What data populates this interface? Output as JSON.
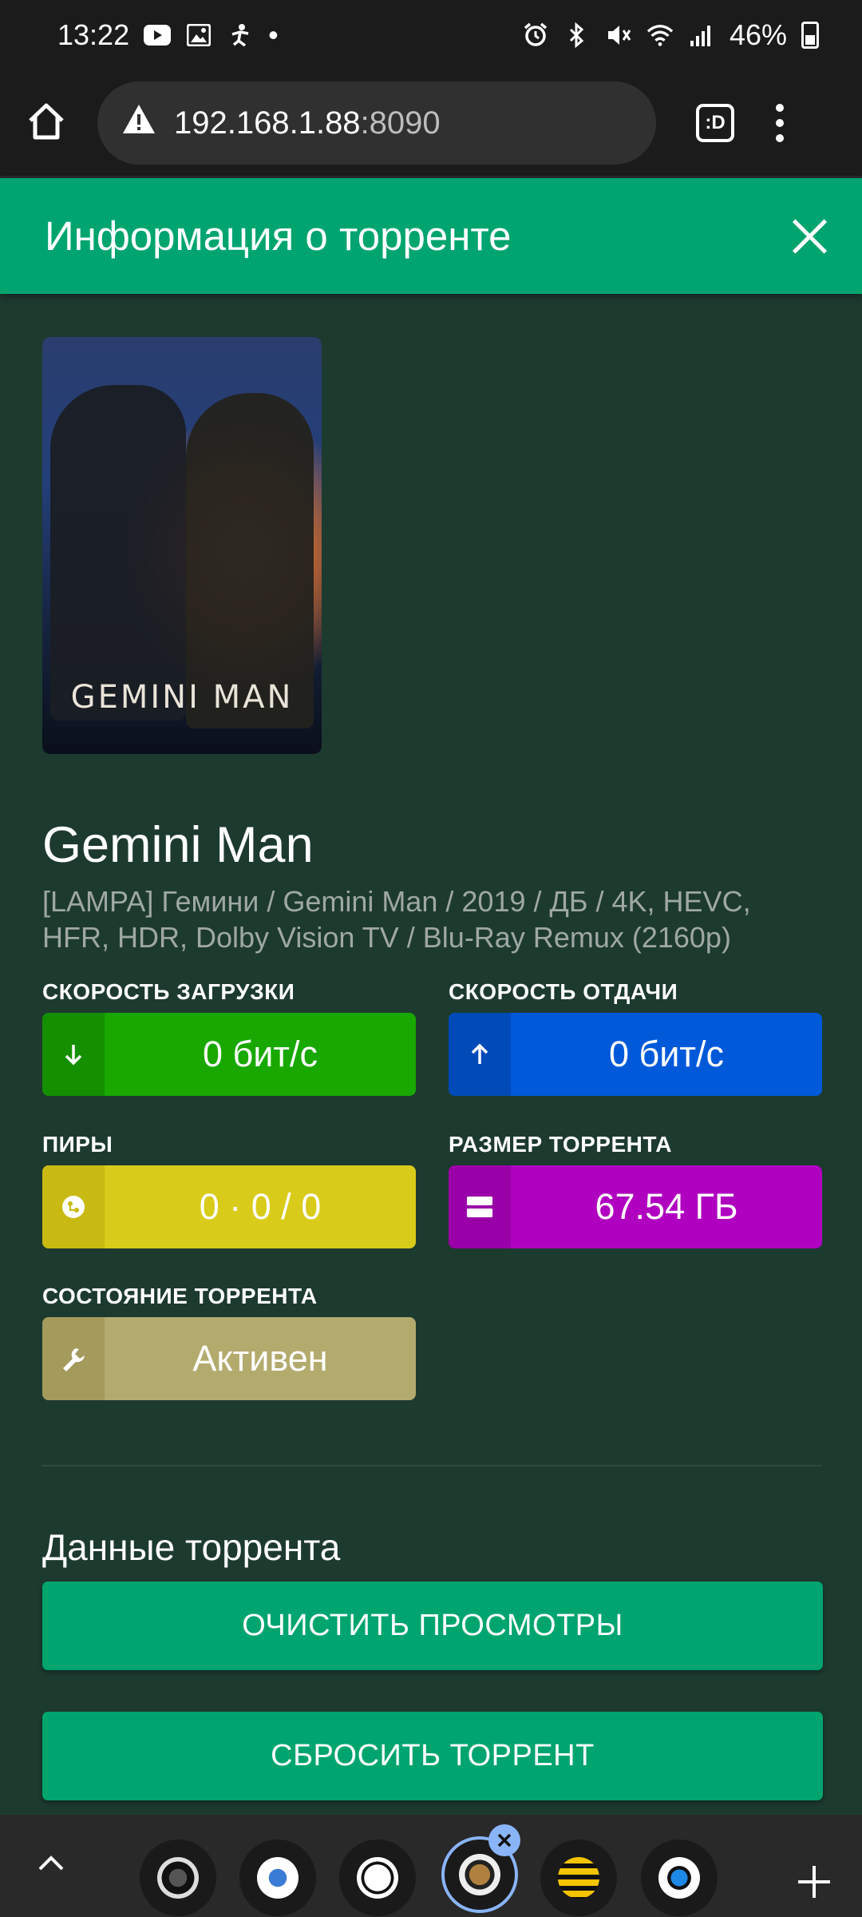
{
  "status_bar": {
    "time": "13:22",
    "battery": "46%"
  },
  "browser": {
    "url_host": "192.168.1.88",
    "url_port": ":8090",
    "tab_label": ":D"
  },
  "header": {
    "title": "Информация о торренте"
  },
  "poster": {
    "title": "GEMINI MAN"
  },
  "torrent": {
    "title": "Gemini Man",
    "subtitle": "[LAMPA] Гемини / Gemini Man / 2019 / ДБ / 4K, HEVC, HFR, HDR, Dolby Vision TV / Blu-Ray Remux (2160p)"
  },
  "stats": {
    "download": {
      "label": "СКОРОСТЬ ЗАГРУЗКИ",
      "value": "0 бит/с",
      "color": "#18a800"
    },
    "upload": {
      "label": "СКОРОСТЬ ОТДАЧИ",
      "value": "0 бит/с",
      "color": "#0059d9"
    },
    "peers": {
      "label": "ПИРЫ",
      "value": "0 · 0 / 0",
      "color": "#d9cb1a"
    },
    "size": {
      "label": "РАЗМЕР ТОРРЕНТА",
      "value": "67.54 ГБ",
      "color": "#b000c0"
    },
    "state": {
      "label": "СОСТОЯНИЕ ТОРРЕНТА",
      "value": "Активен",
      "color": "#b3aa6e"
    }
  },
  "data_section": {
    "title": "Данные торрента",
    "clear_views_label": "ОЧИСТИТЬ ПРОСМОТРЫ",
    "reset_torrent_label": "СБРОСИТЬ ТОРРЕНТ"
  },
  "accent_color": "#00a46f"
}
